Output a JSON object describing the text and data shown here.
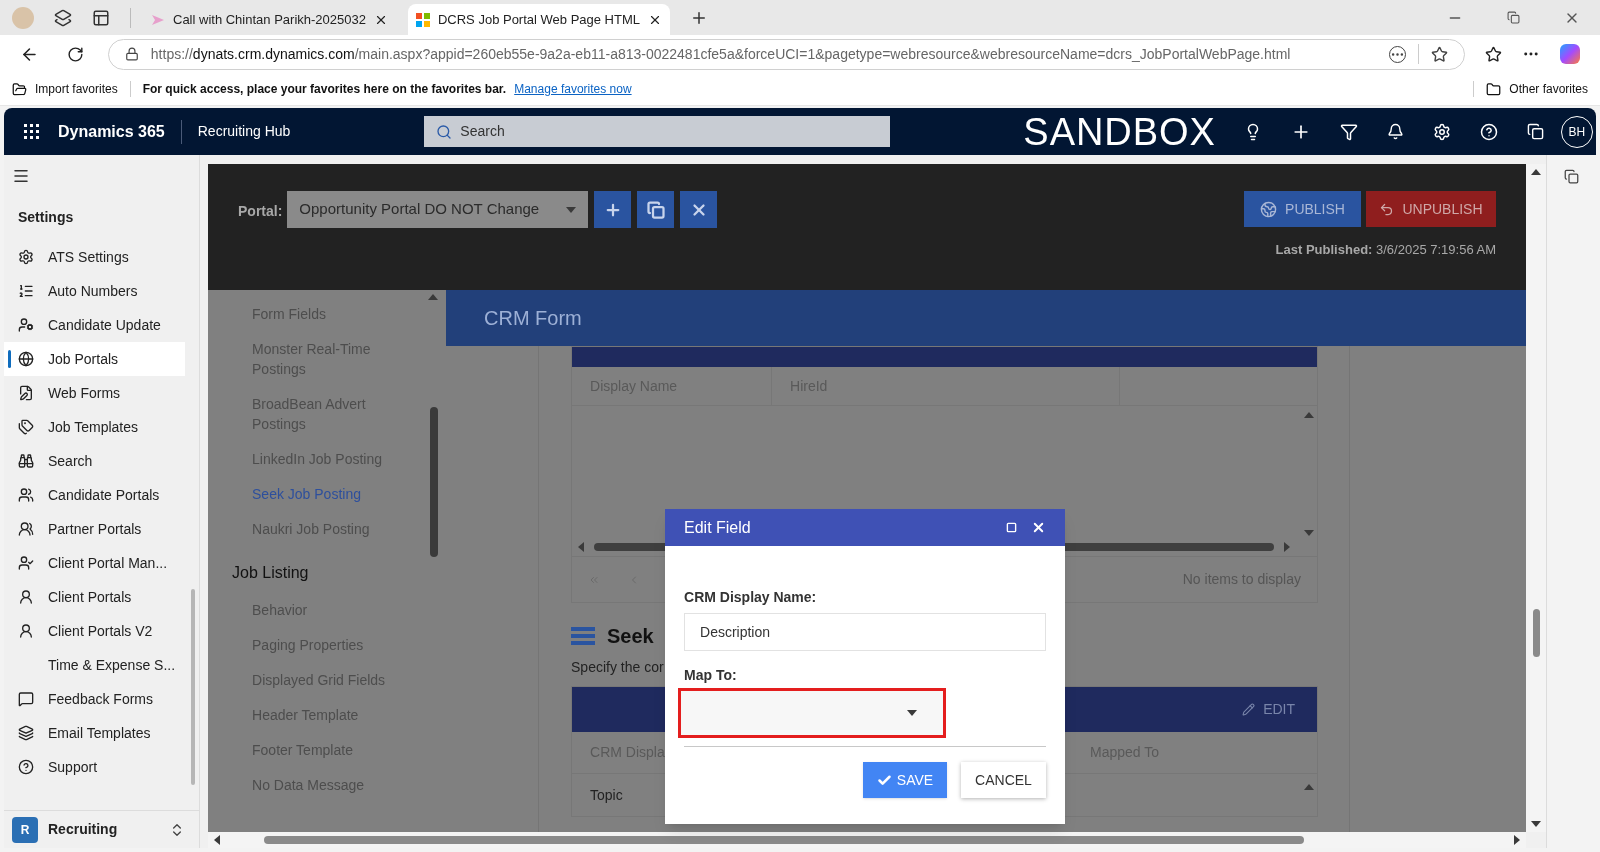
{
  "browser": {
    "tabs": [
      {
        "title": "Call with Chintan Parikh-2025032",
        "selected": false
      },
      {
        "title": "DCRS Job Portal Web Page HTML",
        "selected": true
      }
    ],
    "url": {
      "scheme": "https://",
      "host": "dynats.crm.dynamics.com",
      "path": "/main.aspx?appid=260eb55e-9a2a-eb11-a813-0022481cfe5a&forceUCI=1&pagetype=webresource&webresourceName=dcrs_JobPortalWebPage.html"
    },
    "favorites_bar": {
      "import": "Import favorites",
      "message": "For quick access, place your favorites here on the favorites bar.",
      "link": "Manage favorites now",
      "other": "Other favorites"
    }
  },
  "app_header": {
    "product": "Dynamics 365",
    "area": "Recruiting Hub",
    "search_placeholder": "Search",
    "environment": "SANDBOX",
    "avatar": "BH"
  },
  "sidebar": {
    "title": "Settings",
    "items": [
      {
        "label": "ATS Settings",
        "selected": false
      },
      {
        "label": "Auto Numbers",
        "selected": false
      },
      {
        "label": "Candidate Update",
        "selected": false
      },
      {
        "label": "Job Portals",
        "selected": true
      },
      {
        "label": "Web Forms",
        "selected": false
      },
      {
        "label": "Job Templates",
        "selected": false
      },
      {
        "label": "Search",
        "selected": false
      },
      {
        "label": "Candidate Portals",
        "selected": false
      },
      {
        "label": "Partner Portals",
        "selected": false
      },
      {
        "label": "Client Portal Man...",
        "selected": false
      },
      {
        "label": "Client Portals",
        "selected": false
      },
      {
        "label": "Client Portals V2",
        "selected": false
      },
      {
        "label": "Time & Expense S...",
        "selected": false
      },
      {
        "label": "Feedback Forms",
        "selected": false
      },
      {
        "label": "Email Templates",
        "selected": false
      },
      {
        "label": "Support",
        "selected": false
      }
    ],
    "area": {
      "initial": "R",
      "label": "Recruiting"
    }
  },
  "portal_toolbar": {
    "label": "Portal:",
    "portal": "Opportunity Portal DO NOT Change",
    "publish": "PUBLISH",
    "unpublish": "UNPUBLISH",
    "last_published_label": "Last Published:",
    "last_published": "3/6/2025 7:19:56 AM"
  },
  "section_nav": {
    "items": [
      {
        "label": "Form Fields",
        "selected": false
      },
      {
        "label": "Monster Real-Time Postings",
        "selected": false
      },
      {
        "label": "BroadBean Advert Postings",
        "selected": false
      },
      {
        "label": "LinkedIn Job Posting",
        "selected": false
      },
      {
        "label": "Seek Job Posting",
        "selected": true
      },
      {
        "label": "Naukri Job Posting",
        "selected": false
      }
    ],
    "groups": [
      {
        "heading": "Job Listing",
        "items": [
          {
            "label": "Behavior",
            "selected": false
          },
          {
            "label": "Paging Properties",
            "selected": false
          },
          {
            "label": "Displayed Grid Fields",
            "selected": false
          },
          {
            "label": "Header Template",
            "selected": false
          },
          {
            "label": "Footer Template",
            "selected": false
          },
          {
            "label": "No Data Message",
            "selected": false
          }
        ]
      }
    ]
  },
  "crm_form": {
    "title": "CRM Form",
    "grid": {
      "columns": [
        "Display Name",
        "HireId"
      ],
      "pager_text": "No items to display"
    },
    "section": {
      "title": "Seek",
      "description": "Specify the cor"
    },
    "mapping_grid": {
      "edit": "EDIT",
      "columns": [
        "CRM Displa",
        "Mapped To"
      ],
      "rows": [
        [
          "Topic"
        ]
      ]
    }
  },
  "modal": {
    "title": "Edit Field",
    "display_name_label": "CRM Display Name:",
    "display_name_value": "Description",
    "map_to_label": "Map To:",
    "map_to_highlighted": true,
    "save": "SAVE",
    "cancel": "CANCEL"
  }
}
